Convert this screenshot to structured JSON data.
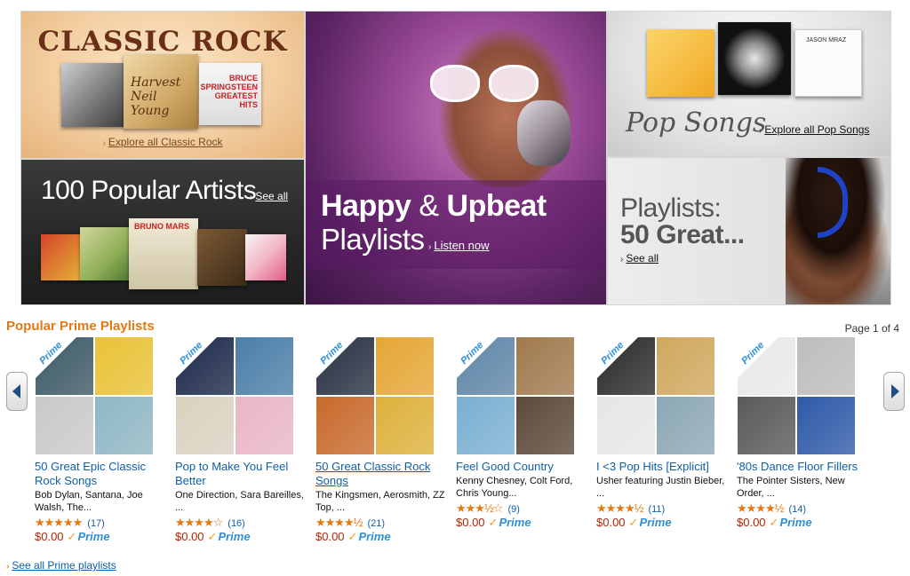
{
  "hero": {
    "classic_rock": {
      "title": "CLASSIC ROCK",
      "album_harvest_text": "Harvest Neil Young",
      "album_bruce_text": "BRUCE SPRINGSTEEN GREATEST HITS",
      "link": "Explore all Classic Rock"
    },
    "artists": {
      "title": "100 Popular Artists",
      "album_bruno_text": "BRUNO MARS",
      "link": "See all"
    },
    "happy": {
      "title_bold_1": "Happy",
      "amp": "&",
      "title_bold_2": "Upbeat",
      "subtitle": "Playlists",
      "link": "Listen now"
    },
    "pop": {
      "title": "Pop Songs",
      "album_3_text": "JASON MRAZ",
      "link": "Explore all Pop Songs"
    },
    "playlists50": {
      "line1": "Playlists:",
      "line2": "50 Great...",
      "link": "See all"
    }
  },
  "section": {
    "title": "Popular Prime Playlists",
    "page_indicator": "Page 1 of 4",
    "see_all": "See all Prime playlists"
  },
  "prime_label": "Prime",
  "cards": [
    {
      "title": "50 Great Epic Classic Rock Songs",
      "underline": false,
      "artists": "Bob Dylan, Santana, Joe Walsh, The...",
      "stars": "★★★★★",
      "count": "(17)",
      "price": "$0.00",
      "colors": [
        "#3d5a66",
        "#e9c236",
        "#c9c9c9",
        "#8fb7c4"
      ]
    },
    {
      "title": "Pop to Make You Feel Better",
      "underline": false,
      "artists": "One Direction, Sara Bareilles, ...",
      "stars": "★★★★☆",
      "count": "(16)",
      "price": "$0.00",
      "colors": [
        "#1c2a4a",
        "#4b7fa8",
        "#d8d2c0",
        "#e9b6c6"
      ]
    },
    {
      "title": "50 Great Classic Rock Songs",
      "underline": true,
      "artists": "The Kingsmen, Aerosmith, ZZ Top, ...",
      "stars": "★★★★½",
      "count": "(21)",
      "price": "$0.00",
      "colors": [
        "#2a3142",
        "#e5a635",
        "#c86a2c",
        "#ddb13c"
      ]
    },
    {
      "title": "Feel Good Country",
      "underline": false,
      "artists": "Kenny Chesney, Colt Ford, Chris Young...",
      "stars": "★★★½☆",
      "count": "(9)",
      "price": "$0.00",
      "colors": [
        "#5f86a8",
        "#a07a4e",
        "#7ab0d2",
        "#5d4a3a"
      ]
    },
    {
      "title": "I <3 Pop Hits [Explicit]",
      "underline": false,
      "artists": "Usher featuring Justin Bieber, ...",
      "stars": "★★★★½",
      "count": "(11)",
      "price": "$0.00",
      "colors": [
        "#2b2b2b",
        "#cfa85e",
        "#e6e6e6",
        "#8ca8b5"
      ]
    },
    {
      "title": "'80s Dance Floor Fillers",
      "underline": false,
      "artists": "The Pointer Sisters, New Order, ...",
      "stars": "★★★★½",
      "count": "(14)",
      "price": "$0.00",
      "colors": [
        "#e8e8e8",
        "#bdbdbd",
        "#5a5a5a",
        "#2f5aa8"
      ]
    }
  ],
  "colors": {
    "section_title": "#e47911",
    "link": "#0f5ea8",
    "price": "#b12704",
    "prime_blue": "#2f8ed6"
  }
}
